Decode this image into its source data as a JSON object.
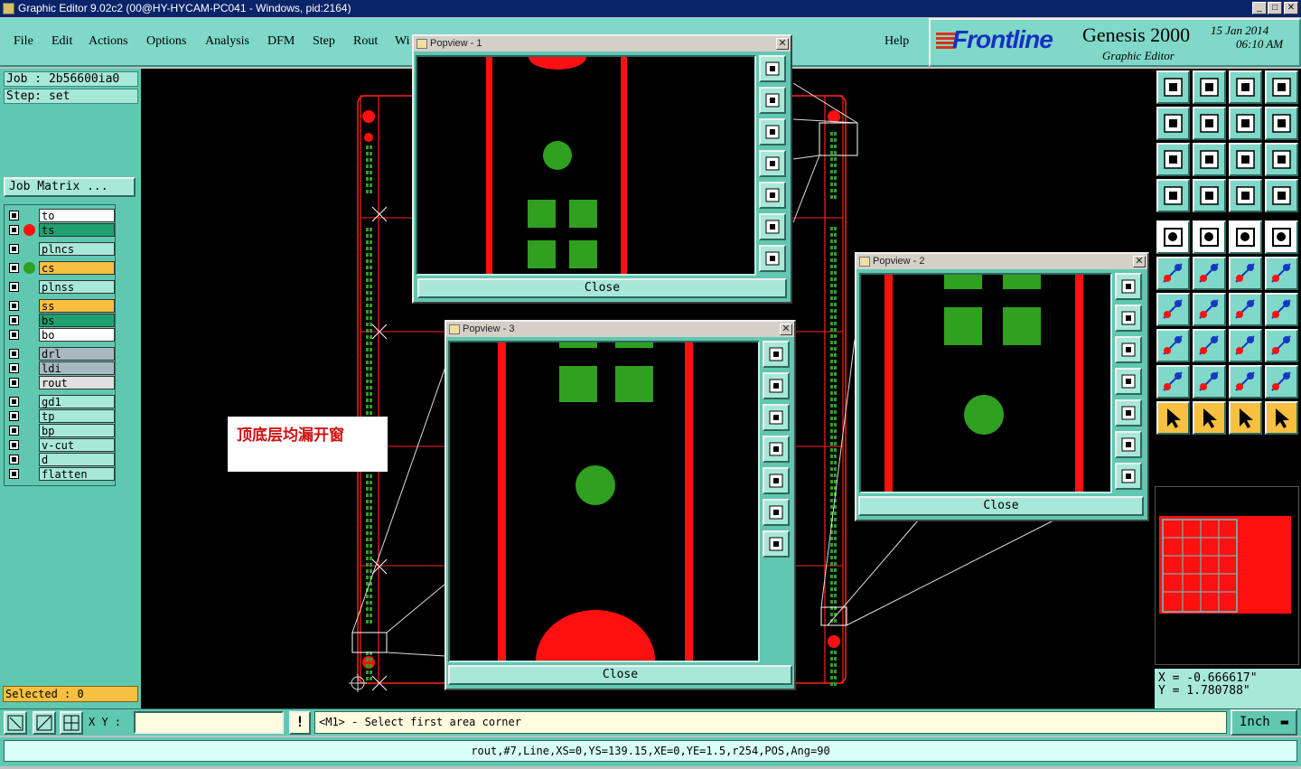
{
  "window": {
    "title": "Graphic Editor 9.02c2 (00@HY-HYCAM-PC041 - Windows, pid:2164)",
    "min": "_",
    "max": "□",
    "close": "✕"
  },
  "menu": {
    "items": [
      "File",
      "Edit",
      "Actions",
      "Options",
      "Analysis",
      "DFM",
      "Step",
      "Rout",
      "Wi"
    ],
    "help": "Help"
  },
  "logo": {
    "brand": "Frontline",
    "product": "Genesis 2000",
    "subtitle": "Graphic Editor",
    "date": "15 Jan 2014",
    "time": "06:10 AM"
  },
  "left": {
    "job": "Job : 2b56600ia0",
    "step": "Step: set",
    "job_matrix": "Job Matrix ...",
    "selected": "Selected : 0",
    "layers": [
      {
        "name": "to",
        "bg": "#ffffff",
        "dot": ""
      },
      {
        "name": "ts",
        "bg": "#20a070",
        "dot": "#ff1010"
      },
      {
        "name": "plncs",
        "bg": "#a8e8d8",
        "dot": ""
      },
      {
        "name": "cs",
        "bg": "#f8c040",
        "dot": "#30a020"
      },
      {
        "name": "plnss",
        "bg": "#a8e8d8",
        "dot": ""
      },
      {
        "name": "ss",
        "bg": "#f8c040",
        "dot": ""
      },
      {
        "name": "bs",
        "bg": "#20a070",
        "dot": ""
      },
      {
        "name": "bo",
        "bg": "#ffffff",
        "dot": ""
      },
      {
        "name": "drl",
        "bg": "#a8b8c0",
        "dot": ""
      },
      {
        "name": "ldi",
        "bg": "#a8b8c0",
        "dot": ""
      },
      {
        "name": "rout",
        "bg": "#e0e0e0",
        "dot": ""
      },
      {
        "name": "gd1",
        "bg": "#a8e8d8",
        "dot": ""
      },
      {
        "name": "tp",
        "bg": "#a8e8d8",
        "dot": ""
      },
      {
        "name": "bp",
        "bg": "#a8e8d8",
        "dot": ""
      },
      {
        "name": "v-cut",
        "bg": "#a8e8d8",
        "dot": ""
      },
      {
        "name": "d",
        "bg": "#a8e8d8",
        "dot": ""
      },
      {
        "name": "flatten",
        "bg": "#a8e8d8",
        "dot": ""
      }
    ]
  },
  "popups": [
    {
      "title": "Popview - 1",
      "close_label": "Close"
    },
    {
      "title": "Popview - 2",
      "close_label": "Close"
    },
    {
      "title": "Popview - 3",
      "close_label": "Close"
    }
  ],
  "annotation": "顶底层均漏开窗",
  "coords": {
    "x": "X = -0.666617\"",
    "y": "Y =  1.780788\""
  },
  "cmd": {
    "xy_label": "X Y :",
    "xy_value": "",
    "warn": "!",
    "prompt": "<M1> - Select first area corner",
    "unit": "Inch"
  },
  "status": "rout,#7,Line,XS=0,YS=139.15,XE=0,YE=1.5,r254,POS,Ang=90",
  "colors": {
    "copper": "#ff1010",
    "pad": "#30a020",
    "panel": "#60c8b0",
    "button": "#7fd8c8"
  }
}
